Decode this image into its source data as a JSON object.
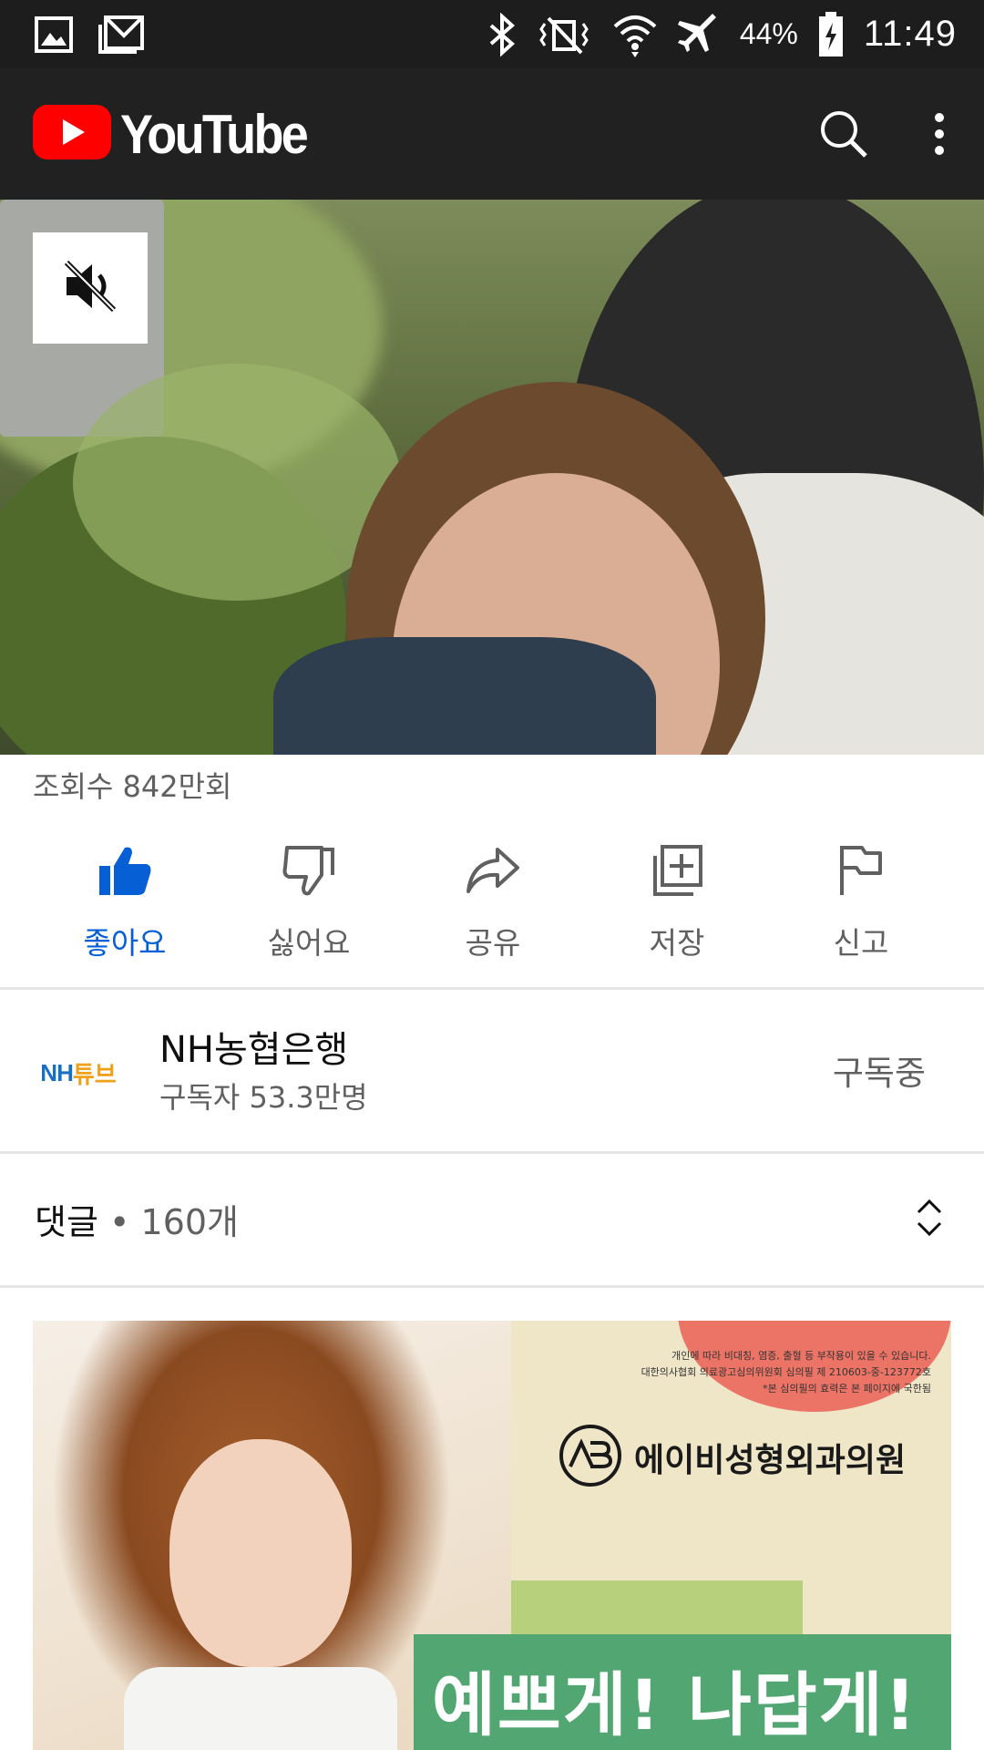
{
  "status_bar": {
    "battery": "44%",
    "time": "11:49",
    "left_icons": [
      "gallery-icon",
      "email-icon"
    ],
    "right_icons": [
      "bluetooth-icon",
      "vibrate-off-icon",
      "wifi-icon",
      "airplane-icon",
      "battery-icon"
    ]
  },
  "app_bar": {
    "logo_text": "YouTube",
    "brand_color": "#ff0000"
  },
  "video": {
    "mute_icon": "volume-off-icon"
  },
  "meta": {
    "views": "조회수 842만회"
  },
  "actions": [
    {
      "label": "좋아요",
      "icon": "thumbs-up-icon",
      "active": true
    },
    {
      "label": "싫어요",
      "icon": "thumbs-down-icon",
      "active": false
    },
    {
      "label": "공유",
      "icon": "share-icon",
      "active": false
    },
    {
      "label": "저장",
      "icon": "add-to-playlist-icon",
      "active": false
    },
    {
      "label": "신고",
      "icon": "flag-icon",
      "active": false
    }
  ],
  "channel": {
    "name": "NH농협은행",
    "subscribers": "구독자 53.3만명",
    "subscribe_label": "구독중",
    "avatar_text_a": "NH",
    "avatar_text_b": "튜브"
  },
  "comments": {
    "title": "댓글",
    "separator": "•",
    "count": "160개"
  },
  "ad": {
    "fine_print_1": "개인에 따라 비대칭, 염증, 출혈 등 부작용이 있을 수 있습니다.",
    "fine_print_2": "대한의사협회 의료광고심의위원회 심의필 제 210603-중-123772호",
    "fine_print_3": "*본 심의필의 효력은 본 페이지에 국한됨",
    "brand": "에이비성형외과의원",
    "slogan": "예쁘게! 나답게!"
  },
  "colors": {
    "accent": "#065fd4",
    "secondary_text": "#606060"
  }
}
